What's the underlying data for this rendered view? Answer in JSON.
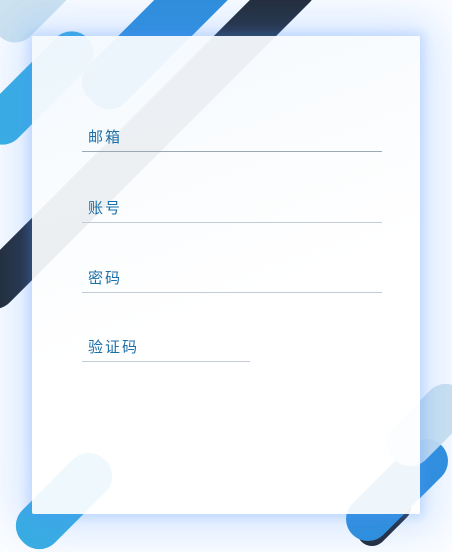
{
  "form": {
    "fields": [
      {
        "label": "邮箱"
      },
      {
        "label": "账号"
      },
      {
        "label": "密码"
      },
      {
        "label": "验证码"
      }
    ]
  },
  "colors": {
    "label": "#1b6fa8",
    "dark_bar": "#232a35",
    "blue_bar": "#39aee2",
    "blue_bar_2": "#2f8fdb",
    "light_bar": "#cfe4ef"
  }
}
